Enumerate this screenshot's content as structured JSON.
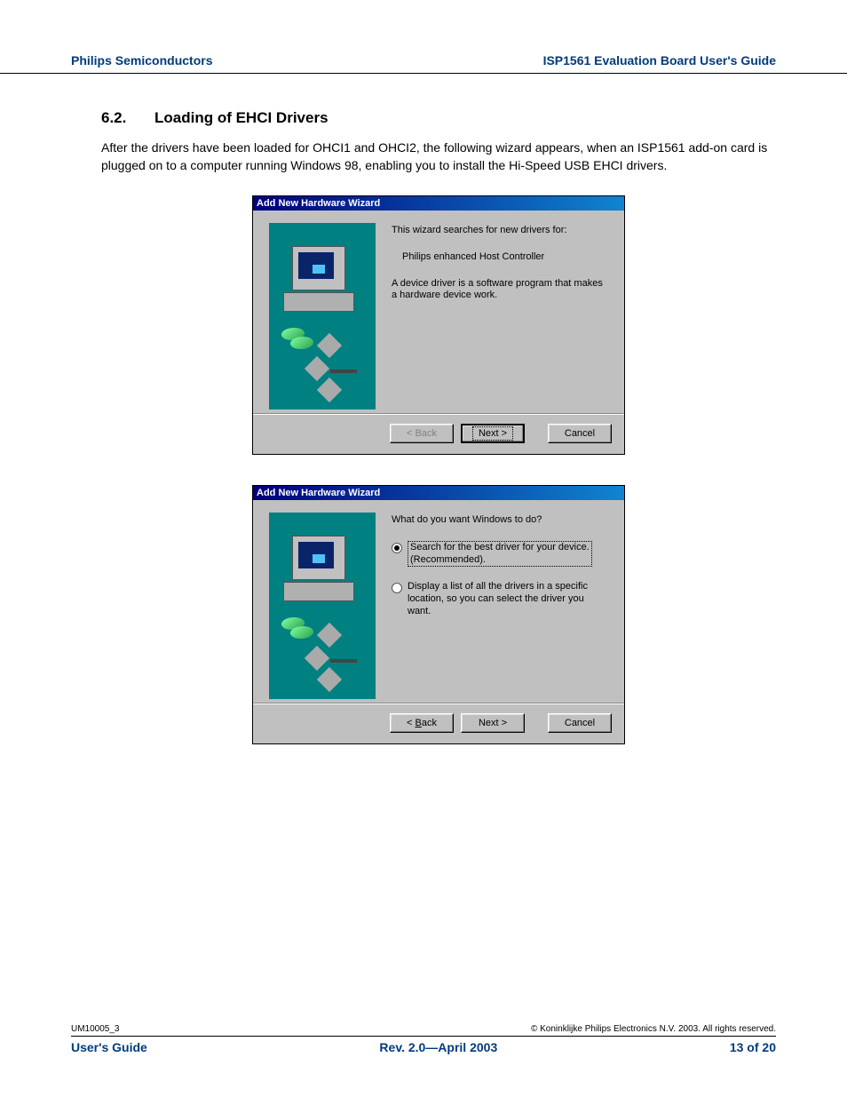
{
  "header": {
    "left": "Philips Semiconductors",
    "right": "ISP1561 Evaluation Board User's Guide"
  },
  "section": {
    "number": "6.2.",
    "title": "Loading of EHCI Drivers",
    "paragraph": "After the drivers have been loaded for OHCI1 and OHCI2, the following wizard appears, when an ISP1561 add-on card is plugged on to a computer running Windows 98, enabling you to install the Hi-Speed USB EHCI drivers."
  },
  "wizard1": {
    "title": "Add New Hardware Wizard",
    "line1": "This wizard searches for new drivers for:",
    "device": "Philips enhanced Host Controller",
    "line2": "A device driver is a software program that makes a hardware device work.",
    "back": "< Back",
    "next": "Next >",
    "cancel": "Cancel"
  },
  "wizard2": {
    "title": "Add New Hardware Wizard",
    "prompt": "What do you want Windows to do?",
    "opt1a": "Search for the best driver for your device.",
    "opt1b": "(Recommended).",
    "opt2": "Display a list of all the drivers in a specific location, so you can select the driver you want.",
    "back_char": "B",
    "back_prefix": "< ",
    "back_suffix": "ack",
    "next": "Next >",
    "cancel": "Cancel"
  },
  "footer": {
    "doc_id": "UM10005_3",
    "copyright": "© Koninklijke Philips Electronics N.V. 2003. All rights reserved.",
    "left": "User's Guide",
    "center": "Rev. 2.0—April 2003",
    "right": "13 of 20"
  }
}
